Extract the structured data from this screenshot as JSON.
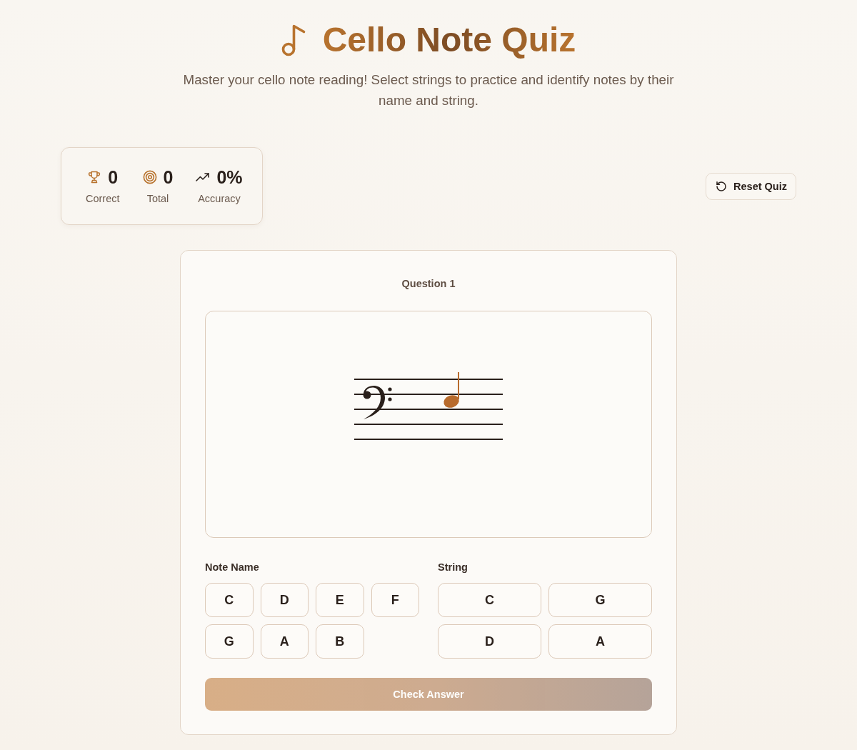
{
  "header": {
    "title": "Cello Note Quiz",
    "subtitle": "Master your cello note reading! Select strings to practice and identify notes by their name and string."
  },
  "stats": [
    {
      "kind": "trophy",
      "value": "0",
      "label": "Correct"
    },
    {
      "kind": "target",
      "value": "0",
      "label": "Total"
    },
    {
      "kind": "trend",
      "value": "0%",
      "label": "Accuracy"
    }
  ],
  "reset_button": {
    "label": "Reset Quiz"
  },
  "quiz": {
    "question": "Question 1",
    "note_name": {
      "label": "Note Name",
      "options": [
        {
          "label": "C",
          "selected": false
        },
        {
          "label": "D",
          "selected": false
        },
        {
          "label": "E",
          "selected": false
        },
        {
          "label": "F",
          "selected": false
        },
        {
          "label": "G",
          "selected": false
        },
        {
          "label": "A",
          "selected": false
        },
        {
          "label": "B",
          "selected": false
        }
      ]
    },
    "string": {
      "label": "String",
      "options": [
        {
          "label": "C",
          "selected": false
        },
        {
          "label": "G",
          "selected": false
        },
        {
          "label": "D",
          "selected": false
        },
        {
          "label": "A",
          "selected": false
        }
      ]
    },
    "check_button": {
      "label": "Check Answer",
      "disabled": true
    }
  }
}
